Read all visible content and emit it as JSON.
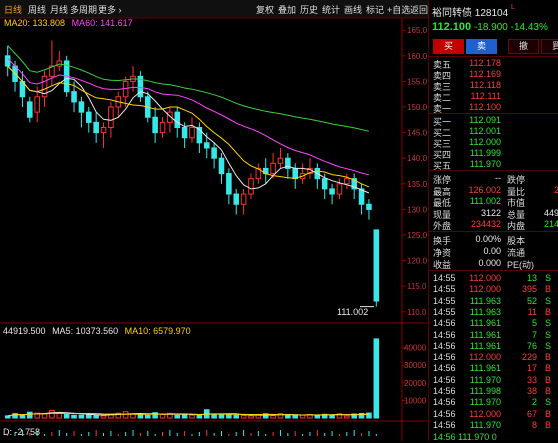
{
  "period_tabs": [
    "日线",
    "周线",
    "月线",
    "多周期",
    "更多 ›"
  ],
  "toolbar": [
    "复权",
    "叠加",
    "历史",
    "统计",
    "画线",
    "标记",
    "+自选",
    "返回"
  ],
  "ma_legend": {
    "ma20": "MA20: 133.808",
    "ma60": "MA60: 141.617"
  },
  "vol_legend": {
    "vol": "44919.500",
    "ma5": "MA5: 10373.560",
    "ma10": "MA10: 6579.970"
  },
  "macd_label": "D: -2.758",
  "price_axis": [
    "165.0",
    "160.0",
    "155.0",
    "150.0",
    "145.0",
    "140.0",
    "135.0",
    "130.0",
    "125.0",
    "120.0",
    "115.0",
    "110.0"
  ],
  "vol_axis": [
    "40000",
    "30000",
    "20000",
    "10000"
  ],
  "low_marker": "111.002",
  "quote": {
    "name": "裕同转债",
    "code": "128104",
    "flag": "L",
    "price": "112.100",
    "change": "-18.900",
    "pct": "-14.43%"
  },
  "actions": [
    "买",
    "卖",
    "撤",
    "買"
  ],
  "asks": [
    {
      "label": "卖五",
      "price": "112.178"
    },
    {
      "label": "卖四",
      "price": "112.169"
    },
    {
      "label": "卖三",
      "price": "112.118"
    },
    {
      "label": "卖二",
      "price": "112.111"
    },
    {
      "label": "卖一",
      "price": "112.100"
    }
  ],
  "bids": [
    {
      "label": "买一",
      "price": "112.091"
    },
    {
      "label": "买二",
      "price": "112.001"
    },
    {
      "label": "买三",
      "price": "112.000"
    },
    {
      "label": "买四",
      "price": "111.999"
    },
    {
      "label": "买五",
      "price": "111.970"
    }
  ],
  "stats": [
    {
      "l1": "涨停",
      "v1": "--",
      "l2": "跌停",
      "v2": ""
    },
    {
      "l1": "最高",
      "v1": "126.002",
      "l2": "量比",
      "v2": "2"
    },
    {
      "l1": "最低",
      "v1": "111.002",
      "l2": "市值",
      "v2": ""
    },
    {
      "l1": "现量",
      "v1": "3122",
      "l2": "总量",
      "v2": "449"
    },
    {
      "l1": "外盘",
      "v1": "234432",
      "l2": "内盘",
      "v2": "214"
    }
  ],
  "stats2": [
    {
      "l1": "换手",
      "v1": "0.00%",
      "l2": "股本"
    },
    {
      "l1": "净资",
      "v1": "0.00",
      "l2": "流通"
    },
    {
      "l1": "收益",
      "v1": "0.000",
      "l2": "PE(动)"
    }
  ],
  "ticks": [
    {
      "t": "14:55",
      "p": "112.000",
      "v": "13",
      "s": "S"
    },
    {
      "t": "14:55",
      "p": "112.000",
      "v": "395",
      "s": "B"
    },
    {
      "t": "14:55",
      "p": "111.963",
      "v": "52",
      "s": "S"
    },
    {
      "t": "14:55",
      "p": "111.963",
      "v": "11",
      "s": "B"
    },
    {
      "t": "14:56",
      "p": "111.961",
      "v": "5",
      "s": "S"
    },
    {
      "t": "14:56",
      "p": "111.961",
      "v": "7",
      "s": "S"
    },
    {
      "t": "14:56",
      "p": "111.961",
      "v": "76",
      "s": "S"
    },
    {
      "t": "14:56",
      "p": "112.000",
      "v": "229",
      "s": "B"
    },
    {
      "t": "14:56",
      "p": "111.961",
      "v": "17",
      "s": "B"
    },
    {
      "t": "14:56",
      "p": "111.970",
      "v": "33",
      "s": "B"
    },
    {
      "t": "14:56",
      "p": "111.998",
      "v": "38",
      "s": "B"
    },
    {
      "t": "14:56",
      "p": "111.970",
      "v": "2",
      "s": "S"
    },
    {
      "t": "14:56",
      "p": "112.000",
      "v": "67",
      "s": "B"
    },
    {
      "t": "14:56",
      "p": "111.970",
      "v": "8",
      "s": "B"
    }
  ],
  "ticks_cut": "14:56 111.970 0",
  "candles": [
    [
      160,
      158,
      162,
      156
    ],
    [
      158,
      155,
      159,
      153
    ],
    [
      155,
      152,
      157,
      150
    ],
    [
      151,
      148,
      152,
      147
    ],
    [
      149,
      152,
      154,
      147
    ],
    [
      152,
      156,
      157,
      150
    ],
    [
      156,
      158,
      163,
      154
    ],
    [
      158,
      159,
      161,
      157
    ],
    [
      159,
      153,
      160,
      152
    ],
    [
      153,
      151,
      155,
      149
    ],
    [
      151,
      149,
      152,
      146
    ],
    [
      149,
      147,
      150,
      145
    ],
    [
      147,
      145,
      149,
      143
    ],
    [
      145,
      146,
      147,
      142
    ],
    [
      146,
      150,
      151,
      144
    ],
    [
      150,
      152,
      153,
      148
    ],
    [
      152,
      155,
      156,
      150
    ],
    [
      155,
      156,
      158,
      153
    ],
    [
      156,
      152,
      157,
      151
    ],
    [
      152,
      148,
      153,
      147
    ],
    [
      148,
      145,
      150,
      143
    ],
    [
      145,
      147,
      148,
      144
    ],
    [
      147,
      149,
      150,
      145
    ],
    [
      149,
      146,
      150,
      144
    ],
    [
      146,
      144,
      147,
      142
    ],
    [
      144,
      146,
      148,
      143
    ],
    [
      146,
      143,
      147,
      141
    ],
    [
      143,
      142,
      145,
      140
    ],
    [
      142,
      140,
      143,
      138
    ],
    [
      140,
      137,
      141,
      135
    ],
    [
      137,
      133,
      138,
      131
    ],
    [
      133,
      131,
      134,
      129
    ],
    [
      131,
      133,
      134,
      129
    ],
    [
      133,
      136,
      137,
      132
    ],
    [
      136,
      138,
      139,
      135
    ],
    [
      138,
      137,
      140,
      135
    ],
    [
      137,
      139,
      141,
      136
    ],
    [
      139,
      140,
      142,
      138
    ],
    [
      140,
      138,
      141,
      136
    ],
    [
      138,
      136,
      139,
      134
    ],
    [
      136,
      137,
      139,
      135
    ],
    [
      137,
      138,
      140,
      136
    ],
    [
      138,
      136,
      139,
      134
    ],
    [
      136,
      134,
      137,
      132
    ],
    [
      134,
      133,
      135,
      131
    ],
    [
      133,
      135,
      136,
      132
    ],
    [
      135,
      136,
      137,
      134
    ],
    [
      136,
      134,
      137,
      132
    ],
    [
      134,
      131,
      135,
      129
    ],
    [
      131,
      130,
      132,
      128
    ],
    [
      126,
      112.1,
      126,
      111
    ]
  ],
  "volumes": [
    1200,
    2500,
    1800,
    3300,
    2800,
    2500,
    4300,
    3100,
    2000,
    1500,
    1700,
    2300,
    1500,
    1200,
    2200,
    2700,
    3600,
    2300,
    1900,
    1500,
    3000,
    2000,
    2600,
    1500,
    2100,
    1600,
    1400,
    4700,
    1800,
    2000,
    2100,
    1600,
    1500,
    1200,
    1900,
    2400,
    1400,
    2500,
    1700,
    1400,
    1600,
    1900,
    1700,
    2100,
    1700,
    2400,
    1100,
    2300,
    2600,
    2800,
    44919
  ]
}
